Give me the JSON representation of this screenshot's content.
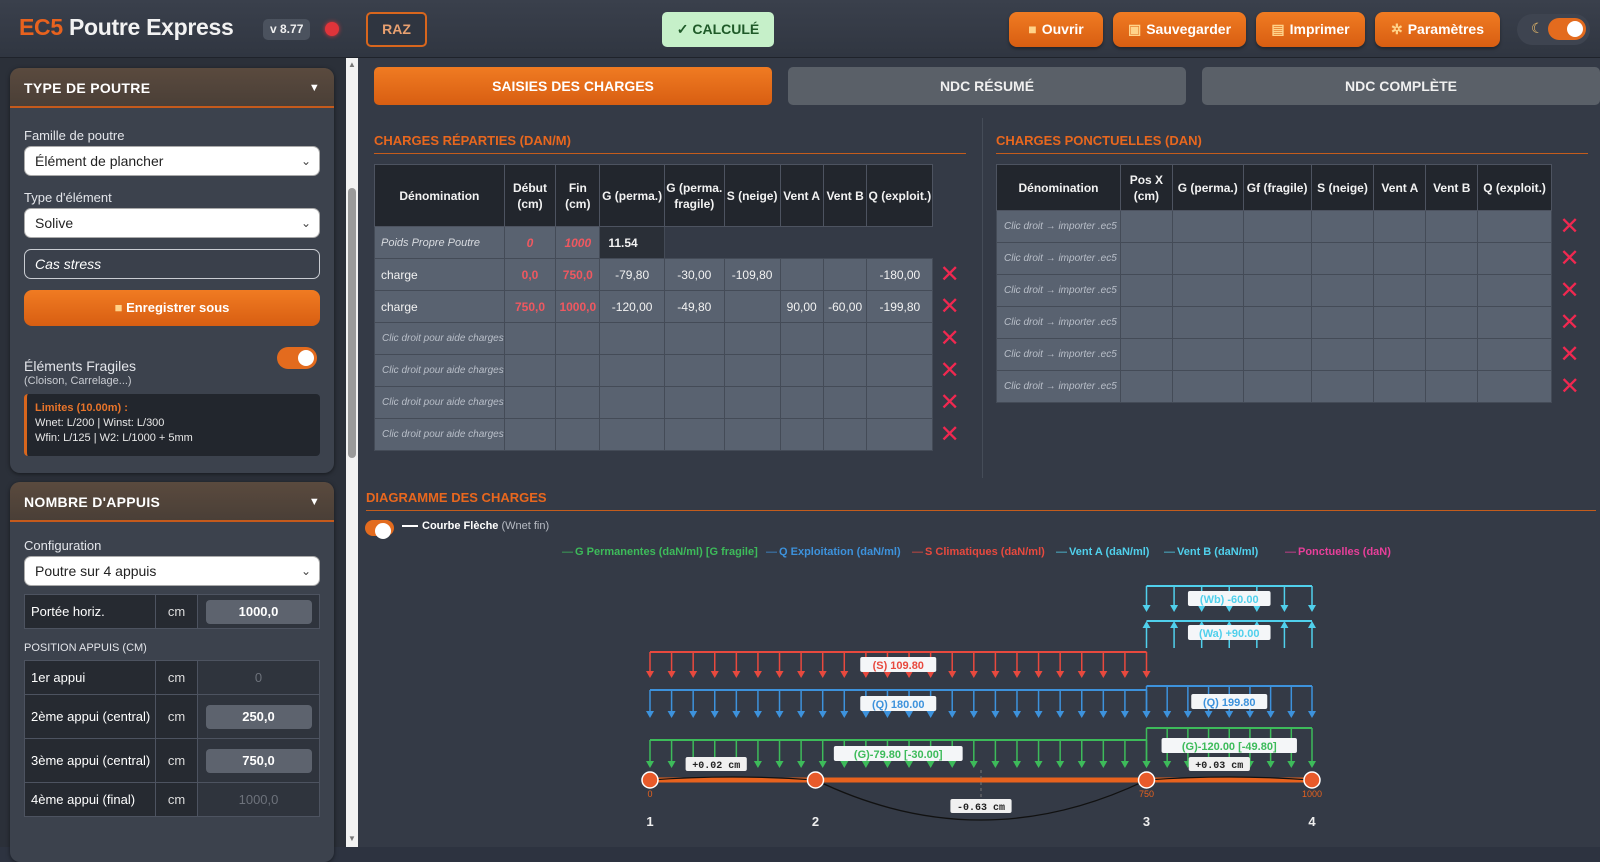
{
  "header": {
    "brand_part1": "EC5",
    "brand_part2": "Poutre Express",
    "version": "v 8.77",
    "raz_label": "RAZ",
    "status_label": "✓ CALCULÉ",
    "open_label": "Ouvrir",
    "save_label": "Sauvegarder",
    "print_label": "Imprimer",
    "settings_label": "Paramètres"
  },
  "sidebar": {
    "beam_type": {
      "title": "TYPE DE POUTRE",
      "family_label": "Famille de poutre",
      "family_value": "Élément de plancher",
      "element_label": "Type d'élément",
      "element_value": "Solive",
      "case_name": "Cas stress",
      "save_as_label": "Enregistrer sous",
      "fragile_label": "Éléments Fragiles",
      "fragile_sub": "(Cloison, Carrelage...)",
      "fragile_on": true,
      "limits_title": "Limites (10.00m) :",
      "limits_line1": "Wnet: L/200 | Winst: L/300",
      "limits_line2": "Wfin: L/125 | W2: L/1000 + 5mm"
    },
    "supports": {
      "title": "NOMBRE D'APPUIS",
      "config_label": "Configuration",
      "config_value": "Poutre sur 4 appuis",
      "span_label": "Portée horiz.",
      "unit": "cm",
      "span_value": "1000,0",
      "positions_title": "POSITION APPUIS (CM)",
      "rows": [
        {
          "label": "1er appui",
          "value": "0"
        },
        {
          "label": "2ème appui (central)",
          "value": "250,0"
        },
        {
          "label": "3ème appui (central)",
          "value": "750,0"
        },
        {
          "label": "4ème appui (final)",
          "value": "1000,0"
        }
      ]
    }
  },
  "tabs": [
    "SAISIES DES CHARGES",
    "NDC RÉSUMÉ",
    "NDC COMPLÈTE"
  ],
  "distributed": {
    "title": "CHARGES RÉPARTIES (DAN/M)",
    "headers": [
      "Dénomination",
      "Début (cm)",
      "Fin (cm)",
      "G (perma.)",
      "G (perma. fragile)",
      "S (neige)",
      "Vent A",
      "Vent B",
      "Q (exploit.)"
    ],
    "self_weight": {
      "name": "Poids Propre Poutre",
      "start": "0",
      "end": "1000",
      "value": "11.54"
    },
    "rows": [
      [
        "charge",
        "0,0",
        "750,0",
        "-79,80",
        "-30,00",
        "-109,80",
        "",
        "",
        "-180,00"
      ],
      [
        "charge",
        "750,0",
        "1000,0",
        "-120,00",
        "-49,80",
        "",
        "90,00",
        "-60,00",
        "-199,80"
      ],
      [
        "Clic droit pour aide charges",
        "",
        "",
        "",
        "",
        "",
        "",
        "",
        ""
      ],
      [
        "Clic droit pour aide charges",
        "",
        "",
        "",
        "",
        "",
        "",
        "",
        ""
      ],
      [
        "Clic droit pour aide charges",
        "",
        "",
        "",
        "",
        "",
        "",
        "",
        ""
      ],
      [
        "Clic droit pour aide charges",
        "",
        "",
        "",
        "",
        "",
        "",
        "",
        ""
      ]
    ]
  },
  "point": {
    "title": "CHARGES PONCTUELLES (DAN)",
    "headers": [
      "Dénomination",
      "Pos X (cm)",
      "G (perma.)",
      "Gf (fragile)",
      "S (neige)",
      "Vent A",
      "Vent B",
      "Q (exploit.)"
    ],
    "placeholder": "Clic droit → importer .ec5",
    "row_count": 6
  },
  "diagram": {
    "title": "DIAGRAMME DES CHARGES",
    "curve_label": "Courbe Flèche",
    "curve_sub": "(Wnet fin)",
    "curve_on": true,
    "legend": [
      {
        "label": "G Permanentes (daN/ml) [G fragile]",
        "color": "#3dbb5a"
      },
      {
        "label": "Q Exploitation (daN/ml)",
        "color": "#3d92dc"
      },
      {
        "label": "S Climatiques (daN/ml)",
        "color": "#e8493e"
      },
      {
        "label": "Vent A (daN/ml)",
        "color": "#50d0ec"
      },
      {
        "label": "Vent B (daN/ml)",
        "color": "#50d0ec"
      },
      {
        "label": "Ponctuelles (daN)",
        "color": "#e83f9a"
      }
    ],
    "labels": {
      "wb": "(Wb) -60.00",
      "wa": "(Wa) +90.00",
      "s": "(S) 109.80",
      "q1": "(Q) 180.00",
      "q2": "(Q) 199.80",
      "g1": "(G)-79.80 [-30.00]",
      "g2": "(G)-120.00 [-49.80]",
      "d1": "+0.02 cm",
      "d2": "+0.03 cm",
      "d3": "-0.63 cm"
    },
    "supports": [
      "1",
      "2",
      "3",
      "4"
    ],
    "support_positions": [
      "0",
      "750",
      "1000"
    ]
  }
}
